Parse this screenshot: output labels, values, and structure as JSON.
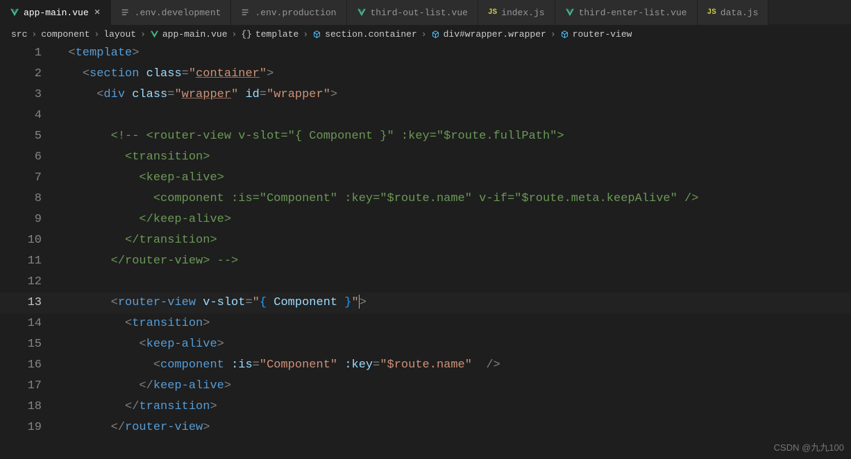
{
  "tabs": [
    {
      "icon": "vue",
      "label": "app-main.vue",
      "active": true,
      "closeable": true
    },
    {
      "icon": "env",
      "label": ".env.development",
      "active": false
    },
    {
      "icon": "env",
      "label": ".env.production",
      "active": false
    },
    {
      "icon": "vue",
      "label": "third-out-list.vue",
      "active": false
    },
    {
      "icon": "js",
      "label": "index.js",
      "active": false
    },
    {
      "icon": "vue",
      "label": "third-enter-list.vue",
      "active": false
    },
    {
      "icon": "js",
      "label": "data.js",
      "active": false
    }
  ],
  "breadcrumbs": [
    {
      "text": "src"
    },
    {
      "text": "component"
    },
    {
      "text": "layout"
    },
    {
      "text": "app-main.vue",
      "icon": "vue"
    },
    {
      "text": "template",
      "icon": "brace"
    },
    {
      "text": "section.container",
      "icon": "cube"
    },
    {
      "text": "div#wrapper.wrapper",
      "icon": "cube"
    },
    {
      "text": "router-view",
      "icon": "cube"
    }
  ],
  "code": {
    "current_line": 13,
    "lines": {
      "1": {
        "t": "template"
      },
      "2": {
        "t": "section",
        "a_class": "class",
        "v_class": "container"
      },
      "3": {
        "t": "div",
        "a_class": "class",
        "v_class": "wrapper",
        "a_id": "id",
        "v_id": "wrapper"
      },
      "5": {
        "open": "<!--",
        "rv": "router-view",
        "vs": "v-slot",
        "vs_v": "{ Component }",
        "key": ":key",
        "key_v": "$route.fullPath"
      },
      "6": {
        "tr": "transition"
      },
      "7": {
        "ka": "keep-alive"
      },
      "8": {
        "cp": "component",
        "is": ":is",
        "is_v": "Component",
        "key": ":key",
        "key_v": "$route.name",
        "vif": "v-if",
        "vif_v": "$route.meta.keepAlive"
      },
      "9": {
        "kac": "keep-alive"
      },
      "10": {
        "trc": "transition"
      },
      "11": {
        "rvc": "router-view",
        "close": "-->"
      },
      "13": {
        "rv": "router-view",
        "vs": "v-slot",
        "vs_lb": "{",
        "vs_c": " Component ",
        "vs_rb": "}"
      },
      "14": {
        "tr": "transition"
      },
      "15": {
        "ka": "keep-alive"
      },
      "16": {
        "cp": "component",
        "is": ":is",
        "is_v": "Component",
        "key": ":key",
        "key_v": "$route.name"
      },
      "17": {
        "kac": "keep-alive"
      },
      "18": {
        "trc": "transition"
      },
      "19": {
        "rvc": "router-view"
      }
    }
  },
  "watermark": "CSDN @九九100"
}
